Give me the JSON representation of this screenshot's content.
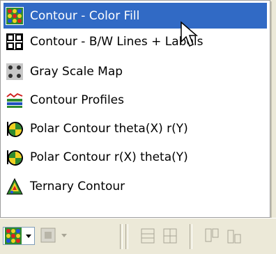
{
  "menu": {
    "items": [
      {
        "label": "Contour - Color Fill",
        "icon": "contour-color-fill-icon",
        "selected": true
      },
      {
        "label": "Contour - B/W Lines + Labels",
        "icon": "contour-bw-lines-icon",
        "selected": false
      },
      {
        "label": "Gray Scale Map",
        "icon": "gray-scale-map-icon",
        "selected": false
      },
      {
        "label": "Contour Profiles",
        "icon": "contour-profiles-icon",
        "selected": false
      },
      {
        "label": "Polar Contour theta(X) r(Y)",
        "icon": "polar-contour-theta-x-icon",
        "selected": false
      },
      {
        "label": "Polar Contour r(X) theta(Y)",
        "icon": "polar-contour-r-x-icon",
        "selected": false
      },
      {
        "label": "Ternary Contour",
        "icon": "ternary-contour-icon",
        "selected": false
      }
    ]
  },
  "colors": {
    "highlight": "#316ac5",
    "toolbar_bg": "#ece9d8"
  }
}
